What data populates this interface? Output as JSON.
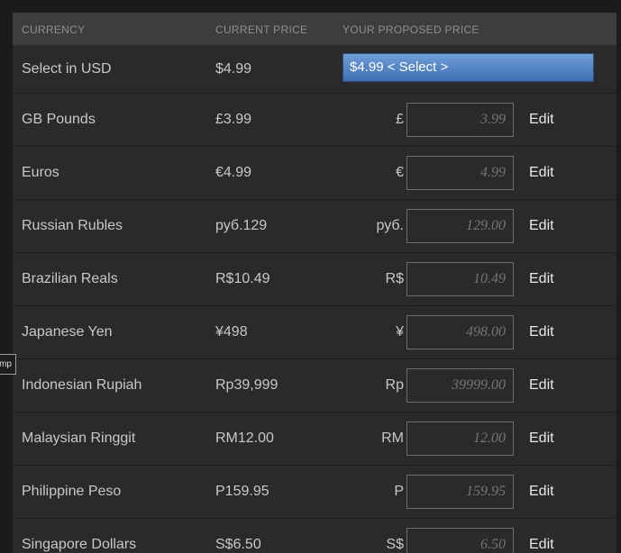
{
  "header": {
    "currency": "CURRENCY",
    "current_price": "CURRENT PRICE",
    "proposed_price": "YOUR PROPOSED PRICE"
  },
  "usd_row": {
    "name": "Select in USD",
    "price": "$4.99",
    "select_value": "$4.99 < Select >"
  },
  "edit_label": "Edit",
  "tooltip": "mp",
  "rows": [
    {
      "name": "GB Pounds",
      "price": "£3.99",
      "symbol": "£",
      "placeholder": "3.99"
    },
    {
      "name": "Euros",
      "price": "€4.99",
      "symbol": "€",
      "placeholder": "4.99"
    },
    {
      "name": "Russian Rubles",
      "price": "руб.129",
      "symbol": "руб.",
      "placeholder": "129.00"
    },
    {
      "name": "Brazilian Reals",
      "price": "R$10.49",
      "symbol": "R$",
      "placeholder": "10.49"
    },
    {
      "name": "Japanese Yen",
      "price": "¥498",
      "symbol": "¥",
      "placeholder": "498.00"
    },
    {
      "name": "Indonesian Rupiah",
      "price": "Rp39,999",
      "symbol": "Rp",
      "placeholder": "39999.00"
    },
    {
      "name": "Malaysian Ringgit",
      "price": "RM12.00",
      "symbol": "RM",
      "placeholder": "12.00"
    },
    {
      "name": "Philippine Peso",
      "price": "P159.95",
      "symbol": "P",
      "placeholder": "159.95"
    },
    {
      "name": "Singapore Dollars",
      "price": "S$6.50",
      "symbol": "S$",
      "placeholder": "6.50"
    }
  ]
}
